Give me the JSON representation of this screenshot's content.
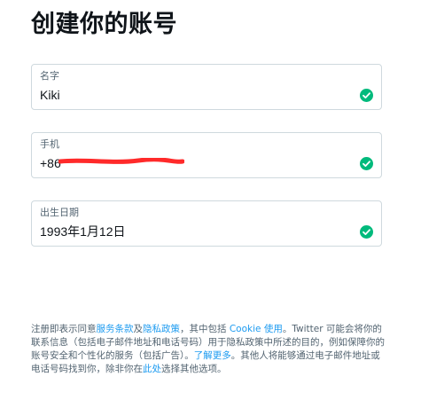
{
  "page": {
    "title": "创建你的账号"
  },
  "fields": {
    "name": {
      "label": "名字",
      "value": "Kiki"
    },
    "phone": {
      "label": "手机",
      "value": "+86"
    },
    "birthdate": {
      "label": "出生日期",
      "value": "1993年1月12日"
    }
  },
  "legal": {
    "part1": "注册即表示同意",
    "terms_link": "服务条款",
    "part2": "及",
    "privacy_link": "隐私政策",
    "part3": "，其中包括 ",
    "cookie_link": "Cookie 使用",
    "part4": "。Twitter 可能会将你的联系信息（包括电子邮件地址和电话号码）用于隐私政策中所述的目的，例如保障你的账号安全和个性化的服务（包括广告）。",
    "learn_more_link": "了解更多",
    "part5": "。其他人将能够通过电子邮件地址或电话号码找到你，除非你在",
    "here_link": "此处",
    "part6": "选择其他选项。"
  },
  "icons": {
    "valid_check": "check-circle-icon"
  },
  "colors": {
    "success": "#00ba7c",
    "link": "#1d9bf0",
    "redaction": "#ff2a2a"
  }
}
